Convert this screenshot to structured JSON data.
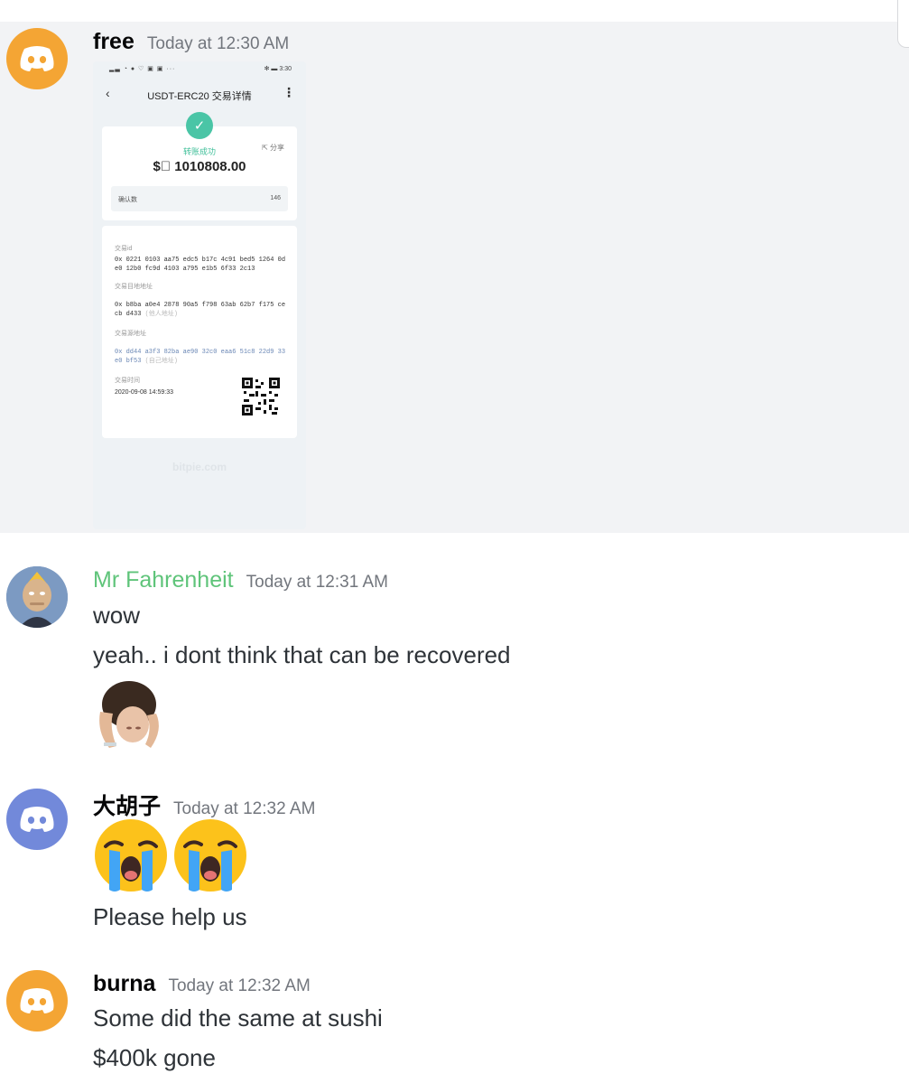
{
  "messages": [
    {
      "username": "free",
      "timestamp": "Today at 12:30 AM",
      "avatar": "discord-default-avatar-orange",
      "attachment": {
        "status_bar_right": "3:30",
        "title": "USDT-ERC20 交易详情",
        "status": "转账成功",
        "share_label": "分享",
        "amount": "1010808.00",
        "confirm_label": "确认数",
        "confirm_count": "146",
        "txid_label": "交易id",
        "txid": "0x 0221 0103 aa75 edc5 b17c 4c91 bed5 1264 0de0 12b0 fc9d 4103 a795 e1b5 6f33 2c13",
        "dest_label": "交易目地地址",
        "dest_address": "0x b8ba a0e4 2878 90a5 f798 63ab 62b7 f175 cecb d433",
        "dest_note": "(他人地址)",
        "src_label": "交易源地址",
        "src_address": "0x dd44 a3f3 82ba ae90 32c0 eaa6 51c8 22d9 33e0 bf53",
        "src_note": "(自己地址)",
        "time_label": "交易时间",
        "time": "2020-09-08 14:59:33",
        "watermark": "bitpie.com"
      }
    },
    {
      "username": "Mr Fahrenheit",
      "timestamp": "Today at 12:31 AM",
      "username_color": "#5fc47a",
      "lines": [
        "wow",
        "yeah.. i dont think that can be recovered"
      ],
      "sticker": "man-holding-head-sticker"
    },
    {
      "username": "大胡子",
      "timestamp": "Today at 12:32 AM",
      "avatar": "discord-default-avatar-blurple",
      "emojis": [
        "loudly-crying-face",
        "loudly-crying-face"
      ],
      "lines": [
        "Please help us"
      ]
    },
    {
      "username": "burna",
      "timestamp": "Today at 12:32 AM",
      "avatar": "discord-default-avatar-orange",
      "lines": [
        "Some did the same at sushi",
        "$400k gone"
      ]
    }
  ],
  "colors": {
    "orange_avatar": "#f4a534",
    "blurple_avatar": "#7289da",
    "highlight_bg": "#f2f3f5",
    "success_green": "#4ac5a6"
  }
}
